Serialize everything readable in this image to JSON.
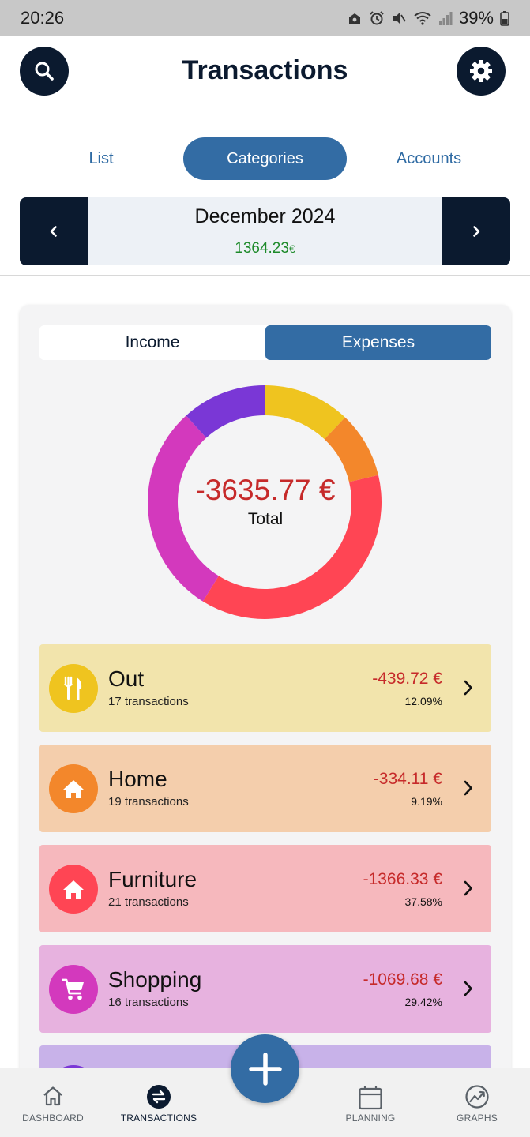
{
  "status_bar": {
    "time": "20:26",
    "battery": "39%"
  },
  "header": {
    "title": "Transactions"
  },
  "view_tabs": [
    {
      "label": "List",
      "active": false
    },
    {
      "label": "Categories",
      "active": true
    },
    {
      "label": "Accounts",
      "active": false
    }
  ],
  "period": {
    "label": "December 2024",
    "balance": "1364.23",
    "currency": "€"
  },
  "type_toggle": {
    "income": "Income",
    "expenses": "Expenses",
    "selected": "Expenses"
  },
  "summary": {
    "total": "-3635.77 €",
    "total_label": "Total"
  },
  "chart_data": {
    "type": "pie",
    "series": [
      {
        "name": "Out",
        "value": 12.09,
        "color": "#efc41f"
      },
      {
        "name": "Home",
        "value": 9.19,
        "color": "#f3872b"
      },
      {
        "name": "Furniture",
        "value": 37.58,
        "color": "#ff4554"
      },
      {
        "name": "Shopping",
        "value": 29.42,
        "color": "#d339bd"
      },
      {
        "value": 11.72,
        "color": "#7a37d6"
      }
    ]
  },
  "categories": [
    {
      "name": "Out",
      "transactions": "17 transactions",
      "amount": "-439.72 €",
      "percent": "12.09%",
      "color": "#efc41f",
      "bg": "#f2e4ac",
      "icon": "restaurant-icon"
    },
    {
      "name": "Home",
      "transactions": "19 transactions",
      "amount": "-334.11 €",
      "percent": "9.19%",
      "color": "#f3872b",
      "bg": "#f4ceac",
      "icon": "home-icon"
    },
    {
      "name": "Furniture",
      "transactions": "21 transactions",
      "amount": "-1366.33 €",
      "percent": "37.58%",
      "color": "#ff4554",
      "bg": "#f6b8bd",
      "icon": "home-icon"
    },
    {
      "name": "Shopping",
      "transactions": "16 transactions",
      "amount": "-1069.68 €",
      "percent": "29.42%",
      "color": "#d339bd",
      "bg": "#e7b2df",
      "icon": "cart-icon"
    },
    {
      "bg": "#c8b2e9",
      "color": "#7a37d6"
    }
  ],
  "bottom_nav": [
    {
      "label": "DASHBOARD",
      "icon": "home-outline-icon"
    },
    {
      "label": "TRANSACTIONS",
      "icon": "swap-icon",
      "active": true
    },
    {
      "label": "PLANNING",
      "icon": "calendar-icon"
    },
    {
      "label": "GRAPHS",
      "icon": "graph-icon"
    }
  ],
  "colors": {
    "navy": "#0b1a2f",
    "accent": "#336ca4",
    "positive": "#1d8a2a",
    "negative": "#c62a2a"
  }
}
